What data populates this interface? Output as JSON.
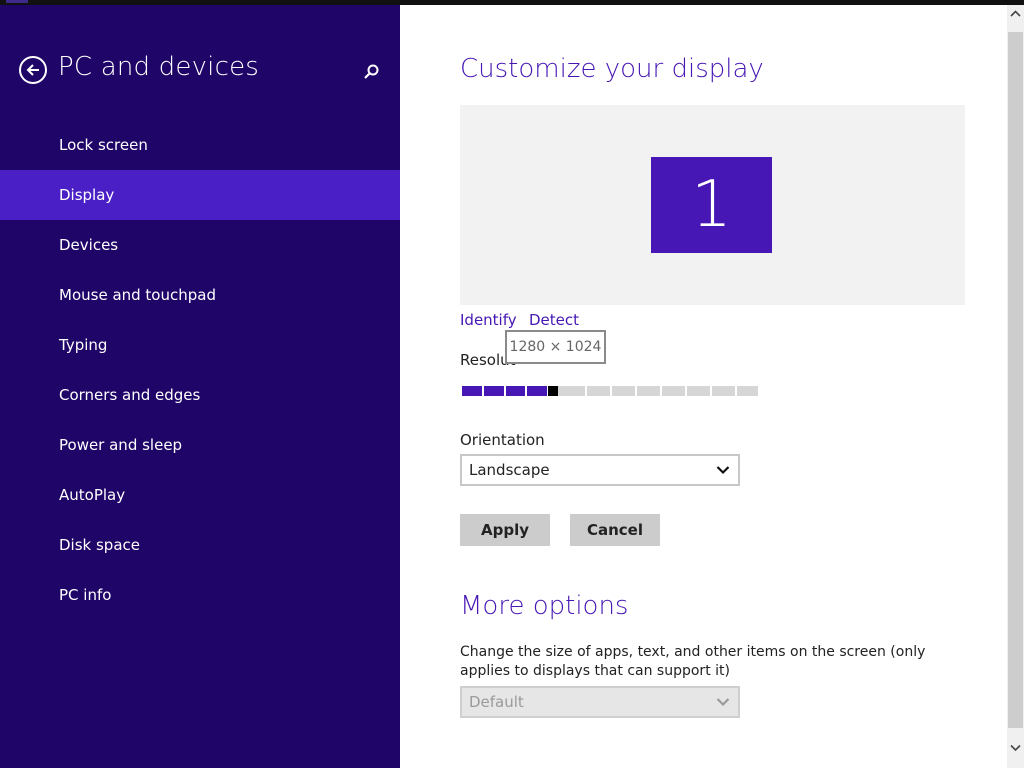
{
  "sidebar": {
    "title": "PC and devices",
    "back_icon": "back-arrow-icon",
    "search_icon": "search-icon",
    "items": [
      {
        "label": "Lock screen"
      },
      {
        "label": "Display",
        "active": true
      },
      {
        "label": "Devices"
      },
      {
        "label": "Mouse and touchpad"
      },
      {
        "label": "Typing"
      },
      {
        "label": "Corners and edges"
      },
      {
        "label": "Power and sleep"
      },
      {
        "label": "AutoPlay"
      },
      {
        "label": "Disk space"
      },
      {
        "label": "PC info"
      }
    ]
  },
  "main": {
    "title": "Customize your display",
    "monitor_number": "1",
    "identify_link": "Identify",
    "detect_link": "Detect",
    "resolution_label": "Resolut",
    "resolution_tooltip": "1280 × 1024",
    "resolution_slider": {
      "steps": 12,
      "selected_step": 4
    },
    "orientation_label": "Orientation",
    "orientation_value": "Landscape",
    "apply_label": "Apply",
    "cancel_label": "Cancel",
    "more_options_title": "More options",
    "scale_description": "Change the size of apps, text, and other items on the screen (only applies to displays that can support it)",
    "scale_value": "Default"
  },
  "colors": {
    "sidebar_bg": "#1f0567",
    "sidebar_active": "#4b1fc6",
    "accent": "#4617b4",
    "button_bg": "#cccccc"
  }
}
